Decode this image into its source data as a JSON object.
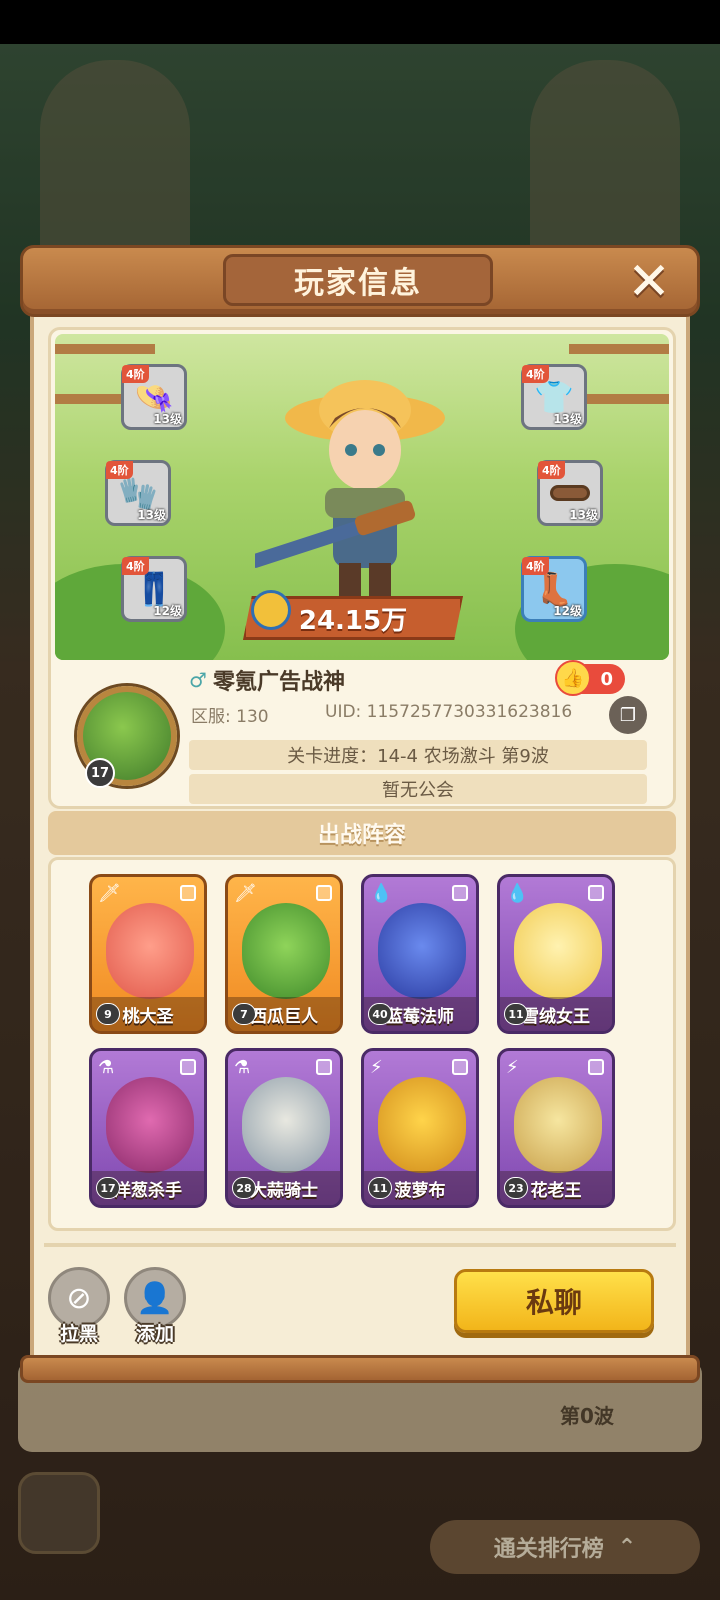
{
  "background": {
    "row_wave": "第0波",
    "ranking_label": "通关排行榜",
    "ranking_chevron": "⌃"
  },
  "dialog": {
    "title": "玩家信息",
    "close_glyph": "✕"
  },
  "player": {
    "name": "零氪广告战神",
    "gender_glyph": "♂",
    "likes": "0",
    "server": "区服: 130",
    "uid": "UID: 1157257730331623816",
    "avatar_level": "17",
    "progress": "关卡进度：14-4  农场激斗 第9波",
    "guild": "暂无公会",
    "power": "24.15万"
  },
  "equipment": [
    {
      "name": "straw-hat",
      "tier": "4阶",
      "level": "13级"
    },
    {
      "name": "jacket",
      "tier": "4阶",
      "level": "13级"
    },
    {
      "name": "gloves",
      "tier": "4阶",
      "level": "13级"
    },
    {
      "name": "belt",
      "tier": "4阶",
      "level": "13级"
    },
    {
      "name": "pants",
      "tier": "4阶",
      "level": "12级"
    },
    {
      "name": "boots",
      "tier": "4阶",
      "level": "12级"
    }
  ],
  "lineup": {
    "title": "出战阵容",
    "cards": [
      {
        "name": "桃大圣",
        "level": "9"
      },
      {
        "name": "西瓜巨人",
        "level": "7"
      },
      {
        "name": "蓝莓法师",
        "level": "40"
      },
      {
        "name": "雪绒女王",
        "level": "11"
      },
      {
        "name": "洋葱杀手",
        "level": "17"
      },
      {
        "name": "大蒜骑士",
        "level": "28"
      },
      {
        "name": "菠萝布",
        "level": "11"
      },
      {
        "name": "花老王",
        "level": "23"
      }
    ]
  },
  "actions": {
    "block_label": "拉黑",
    "add_label": "添加",
    "chat_label": "私聊"
  },
  "colors": {
    "header_wood": "#a46433",
    "panel_cream": "#f6edd6",
    "chat_yellow": "#f2b51a",
    "rare_orange": "#f08a22",
    "epic_purple": "#7f48b0"
  }
}
